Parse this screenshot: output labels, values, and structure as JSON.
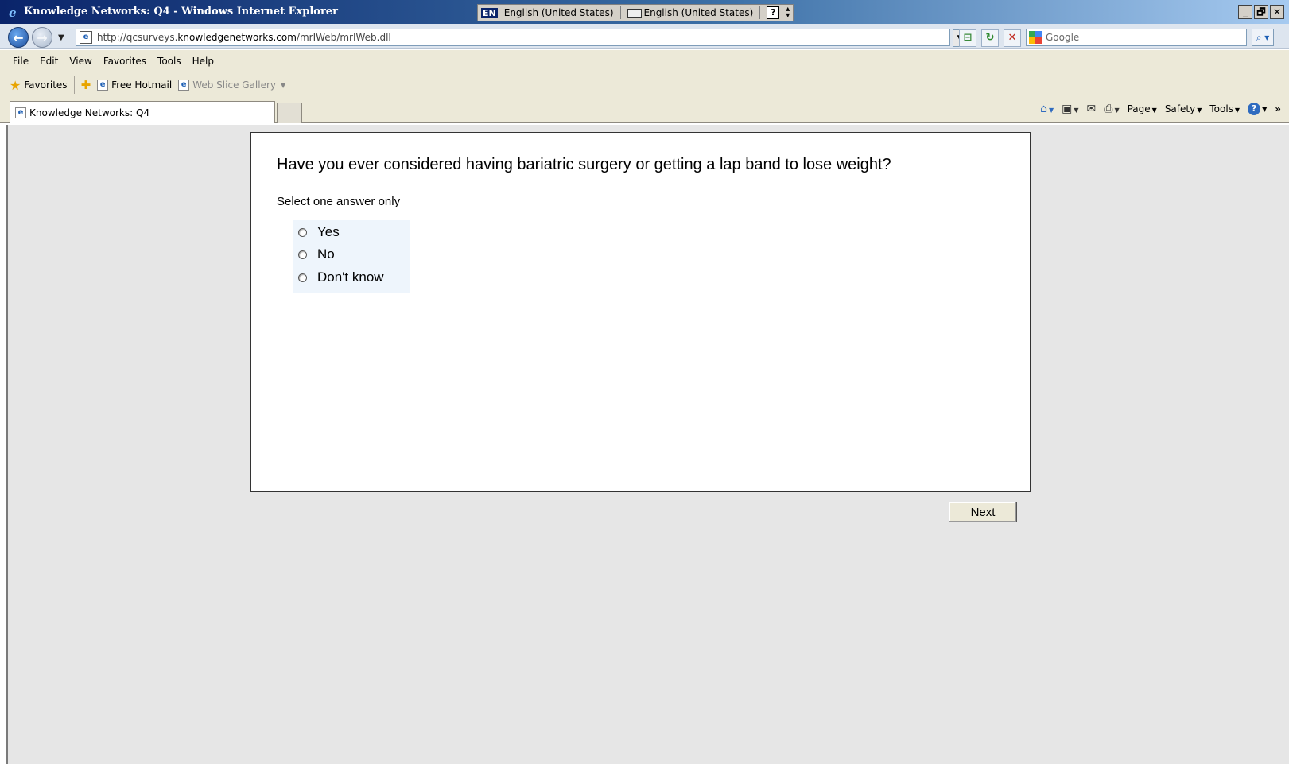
{
  "window": {
    "title": "Knowledge Networks: Q4 - Windows Internet Explorer",
    "lang_input": "English (United States)",
    "lang_keyboard": "English (United States)",
    "help_glyph": "?",
    "min_glyph": "_",
    "max_glyph": "🗗",
    "close_glyph": "✕"
  },
  "navigation": {
    "url_prefix": "http://qcsurveys.",
    "url_domain": "knowledgenetworks.com",
    "url_path": "/mrIWeb/mrIWeb.dll",
    "search_placeholder": "Google"
  },
  "menu": {
    "items": [
      "File",
      "Edit",
      "View",
      "Favorites",
      "Tools",
      "Help"
    ]
  },
  "favorites_bar": {
    "favorites_label": "Favorites",
    "links": [
      "Free Hotmail",
      "Web Slice Gallery"
    ]
  },
  "tabs": {
    "active_label": "Knowledge Networks: Q4"
  },
  "command_bar": {
    "page_label": "Page",
    "safety_label": "Safety",
    "tools_label": "Tools",
    "overflow": "»"
  },
  "survey": {
    "question": "Have you ever considered having bariatric surgery or getting a lap band to lose weight?",
    "instruction": "Select one answer only",
    "options": [
      "Yes",
      "No",
      "Don't know"
    ],
    "selected": null,
    "next_label": "Next"
  }
}
